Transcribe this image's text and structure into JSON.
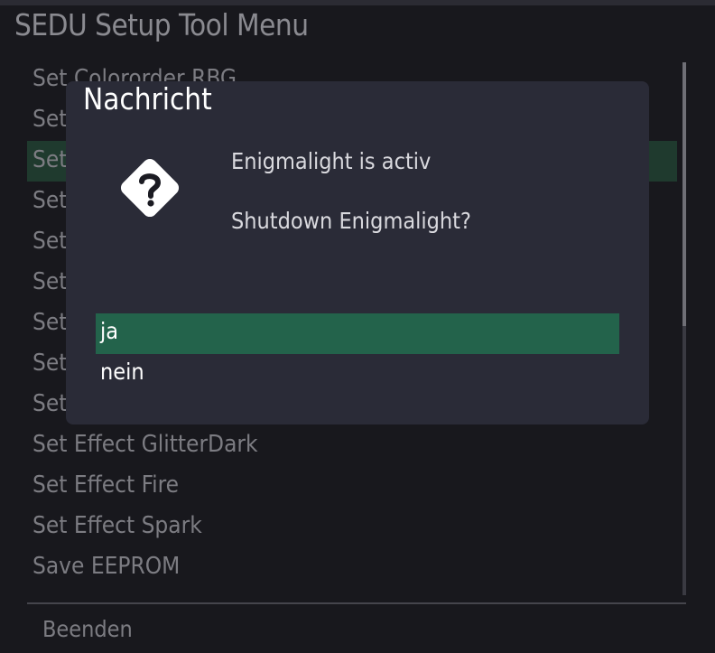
{
  "window": {
    "title": "SEDU Setup Tool Menu"
  },
  "menu": {
    "items": [
      {
        "label": "Set Colororder RBG"
      },
      {
        "label": "Set"
      },
      {
        "label": "Set",
        "selected": true
      },
      {
        "label": "Set"
      },
      {
        "label": "Set"
      },
      {
        "label": "Set"
      },
      {
        "label": "Set"
      },
      {
        "label": "Set"
      },
      {
        "label": "Set"
      },
      {
        "label": "Set Effect GlitterDark"
      },
      {
        "label": "Set Effect Fire"
      },
      {
        "label": "Set Effect Spark"
      },
      {
        "label": "Save EEPROM"
      }
    ]
  },
  "footer": {
    "label": "Beenden"
  },
  "dialog": {
    "title": "Nachricht",
    "icon": "question-diamond-icon",
    "message_line1": "Enigmalight is activ",
    "message_line2": "Shutdown Enigmalight?",
    "choices": [
      {
        "label": "ja",
        "selected": true
      },
      {
        "label": "nein",
        "selected": false
      }
    ]
  },
  "colors": {
    "selection_menu": "#1f3a2e",
    "selection_dialog": "#23634b",
    "dialog_background": "#2a2b37",
    "window_background": "#18181d"
  }
}
